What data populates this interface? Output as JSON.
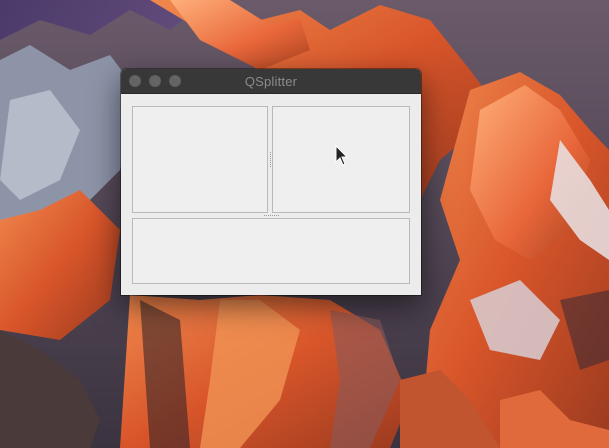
{
  "window": {
    "title": "QSplitter"
  },
  "titlebar": {
    "buttons": [
      "close-button",
      "minimize-button",
      "zoom-button"
    ]
  },
  "panes": [
    "top-left",
    "top-right",
    "bottom"
  ],
  "colors": {
    "titlebar": "#383838",
    "title_text": "#8b8b8b",
    "traffic_light_inactive": "#646464",
    "content_background": "#ececec",
    "pane_border": "#b9b9b9"
  },
  "icons": {
    "cursor": "arrow-pointer-icon"
  }
}
